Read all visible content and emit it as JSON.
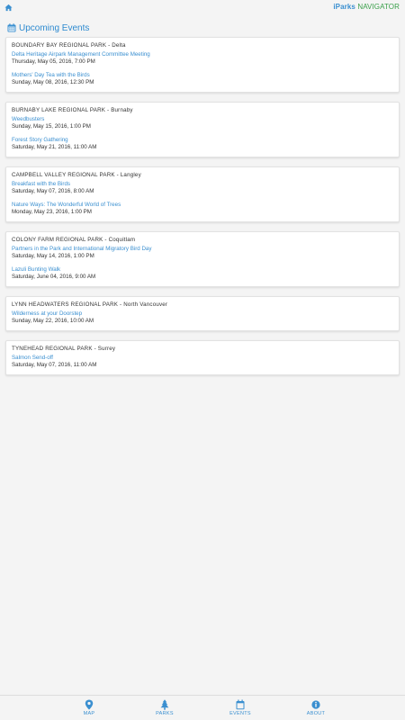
{
  "app": {
    "brand_part1": "iParks",
    "brand_part2": "NAVIGATOR"
  },
  "header": {
    "title": "Upcoming Events",
    "icon": "calendar-icon"
  },
  "cards": [
    {
      "park": "BOUNDARY BAY REGIONAL PARK - Delta",
      "events": [
        {
          "title": "Delta Heritage Airpark Management Committee Meeting",
          "date": "Thursday, May 05, 2016, 7:00 PM"
        },
        {
          "title": "Mothers' Day Tea with the Birds",
          "date": "Sunday, May 08, 2016, 12:30 PM"
        }
      ]
    },
    {
      "park": "BURNABY LAKE REGIONAL PARK - Burnaby",
      "events": [
        {
          "title": "Weedbusters",
          "date": "Sunday, May 15, 2016, 1:00 PM"
        },
        {
          "title": "Forest Story Gathering",
          "date": "Saturday, May 21, 2016, 11:00 AM"
        }
      ]
    },
    {
      "park": "CAMPBELL VALLEY REGIONAL PARK - Langley",
      "events": [
        {
          "title": "Breakfast with the Birds",
          "date": "Saturday, May 07, 2016, 8:00 AM"
        },
        {
          "title": "Nature Ways: The Wonderful World of Trees",
          "date": "Monday, May 23, 2016, 1:00 PM"
        }
      ]
    },
    {
      "park": "COLONY FARM REGIONAL PARK - Coquitlam",
      "events": [
        {
          "title": "Partners in the Park and International Migratory Bird Day",
          "date": "Saturday, May 14, 2016, 1:00 PM"
        },
        {
          "title": "Lazuli Bunting Walk",
          "date": "Saturday, June 04, 2016, 9:00 AM"
        }
      ]
    },
    {
      "park": "LYNN HEADWATERS REGIONAL PARK - North Vancouver",
      "events": [
        {
          "title": "Wilderness at your Doorstep",
          "date": "Sunday, May 22, 2016, 10:00 AM"
        }
      ]
    },
    {
      "park": "TYNEHEAD REGIONAL PARK - Surrey",
      "events": [
        {
          "title": "Salmon Send-off",
          "date": "Saturday, May 07, 2016, 11:00 AM"
        }
      ]
    }
  ],
  "tabs": [
    {
      "label": "MAP",
      "icon": "map-pin-icon"
    },
    {
      "label": "PARKS",
      "icon": "tree-icon"
    },
    {
      "label": "EVENTS",
      "icon": "calendar-icon"
    },
    {
      "label": "ABOUT",
      "icon": "info-icon"
    }
  ],
  "colors": {
    "accent": "#3a8fd0",
    "brand_green": "#3aa04a",
    "background": "#f4f4f4"
  }
}
